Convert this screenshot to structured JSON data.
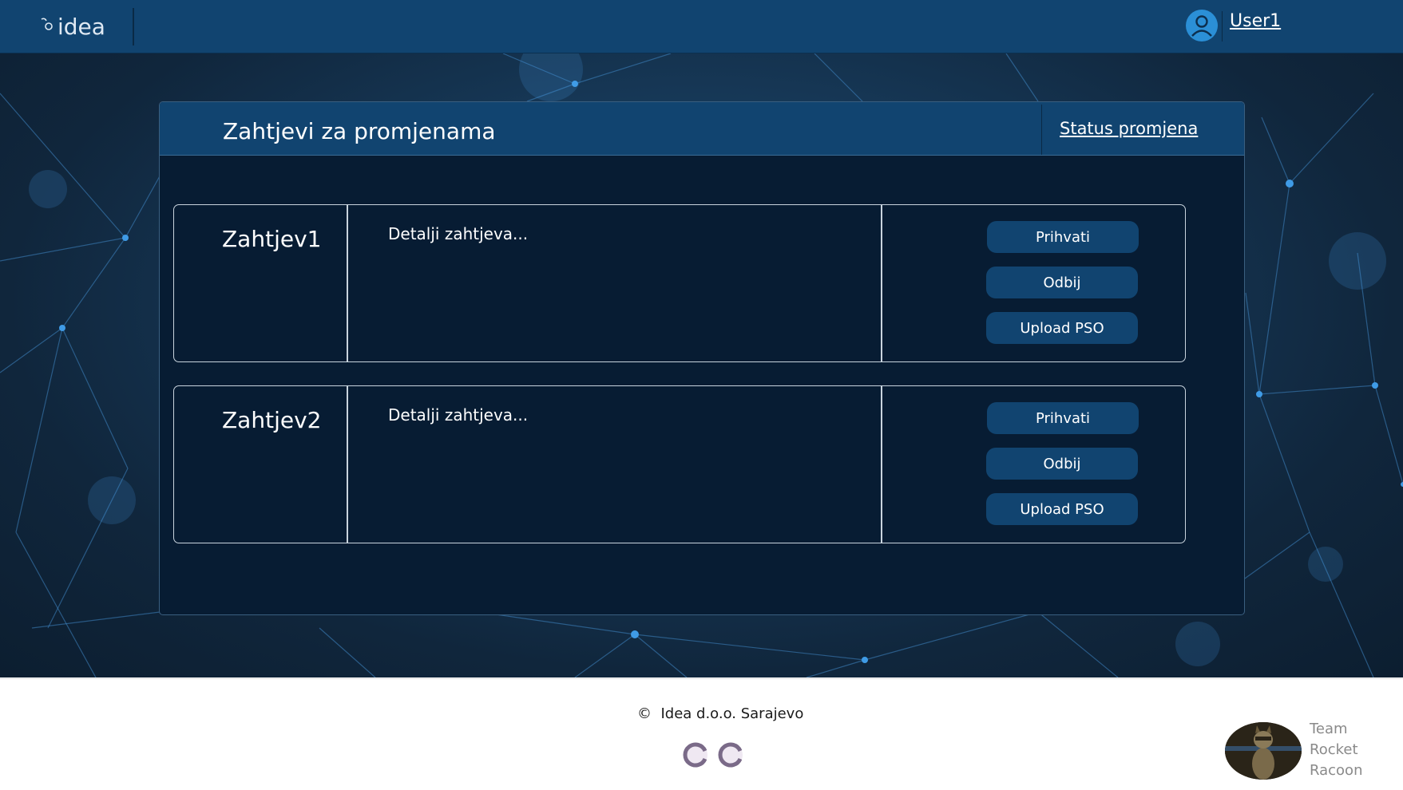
{
  "header": {
    "logo_text": "idea",
    "user_name": "User1"
  },
  "panel": {
    "title": "Zahtjevi za promjenama",
    "status_link": "Status promjena"
  },
  "requests": [
    {
      "name": "Zahtjev1",
      "details": "Detalji zahtjeva...",
      "accept_label": "Prihvati",
      "reject_label": "Odbij",
      "upload_label": "Upload PSO"
    },
    {
      "name": "Zahtjev2",
      "details": "Detalji zahtjeva...",
      "accept_label": "Prihvati",
      "reject_label": "Odbij",
      "upload_label": "Upload PSO"
    }
  ],
  "footer": {
    "copyright_symbol": "©",
    "company": "Idea d.o.o. Sarajevo",
    "team_line1": "Team",
    "team_line2": "Rocket",
    "team_line3": "Racoon"
  },
  "colors": {
    "topbar": "#114470",
    "panel_bg": "#071c33",
    "button_bg": "#114470",
    "accent_blue": "#2b8fd6"
  },
  "icons": {
    "user": "user-avatar-icon",
    "logo": "idea-logo-icon",
    "badges": [
      "badge-icon",
      "badge-icon"
    ],
    "team": "team-raccoon-avatar"
  }
}
